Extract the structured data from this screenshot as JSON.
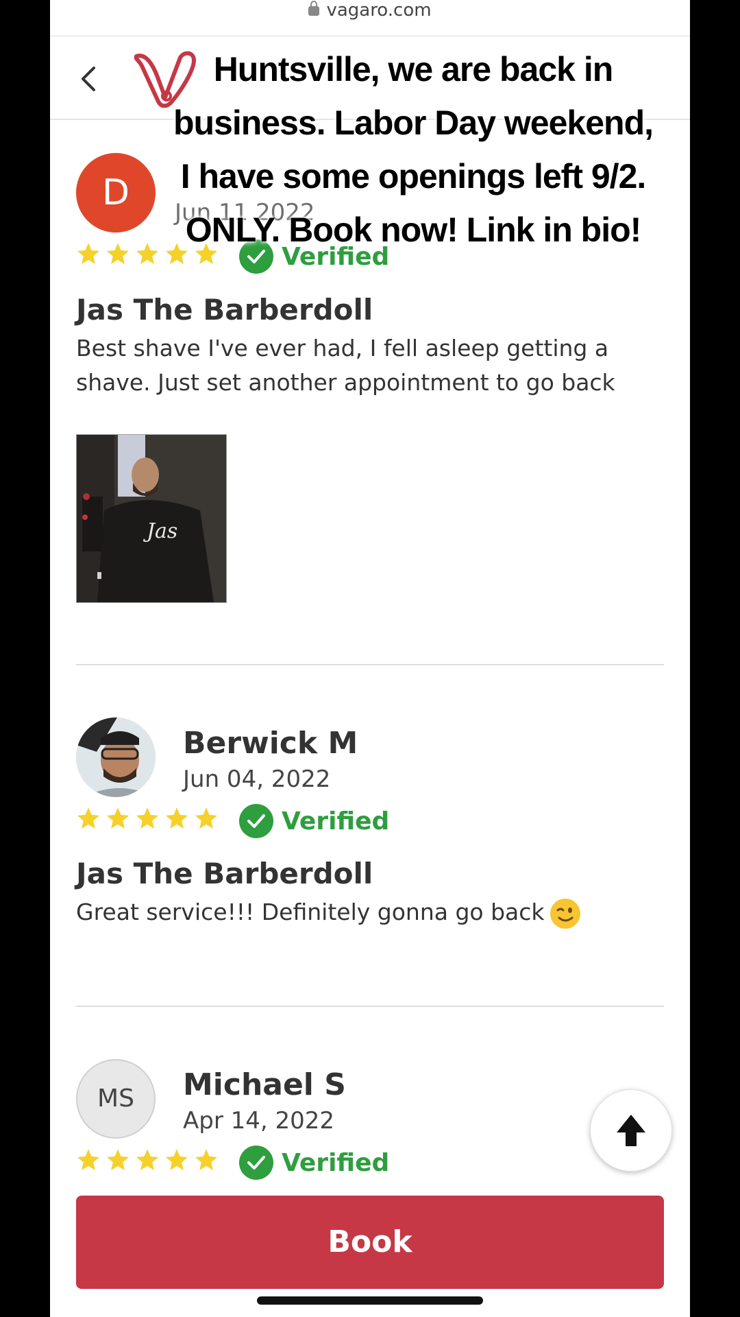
{
  "browser": {
    "url": "vagaro.com"
  },
  "overlay_caption": {
    "text": "Huntsville, we are back in business. Labor Day weekend, I have some openings left 9/2. ONLY. Book now! Link in bio!"
  },
  "reviews": [
    {
      "avatar_initial": "D",
      "date_partial": "Jun 11 2022",
      "stars": 5,
      "verified_label": "Verified",
      "provider": "Jas The Barberdoll",
      "text": "Best shave I've ever had, I fell asleep getting a shave. Just set another appointment to go back"
    },
    {
      "name": "Berwick M",
      "date": "Jun 04, 2022",
      "stars": 5,
      "verified_label": "Verified",
      "provider": "Jas The Barberdoll",
      "text": "Great service!!! Definitely gonna go back"
    },
    {
      "avatar_initial": "MS",
      "name": "Michael S",
      "date": "Apr 14, 2022",
      "stars": 5,
      "verified_label": "Verified"
    }
  ],
  "book_button": {
    "label": "Book"
  },
  "colors": {
    "star": "#f5d12a",
    "verified": "#2e9e3e",
    "book": "#c63846",
    "avatar_d": "#e0472a"
  }
}
